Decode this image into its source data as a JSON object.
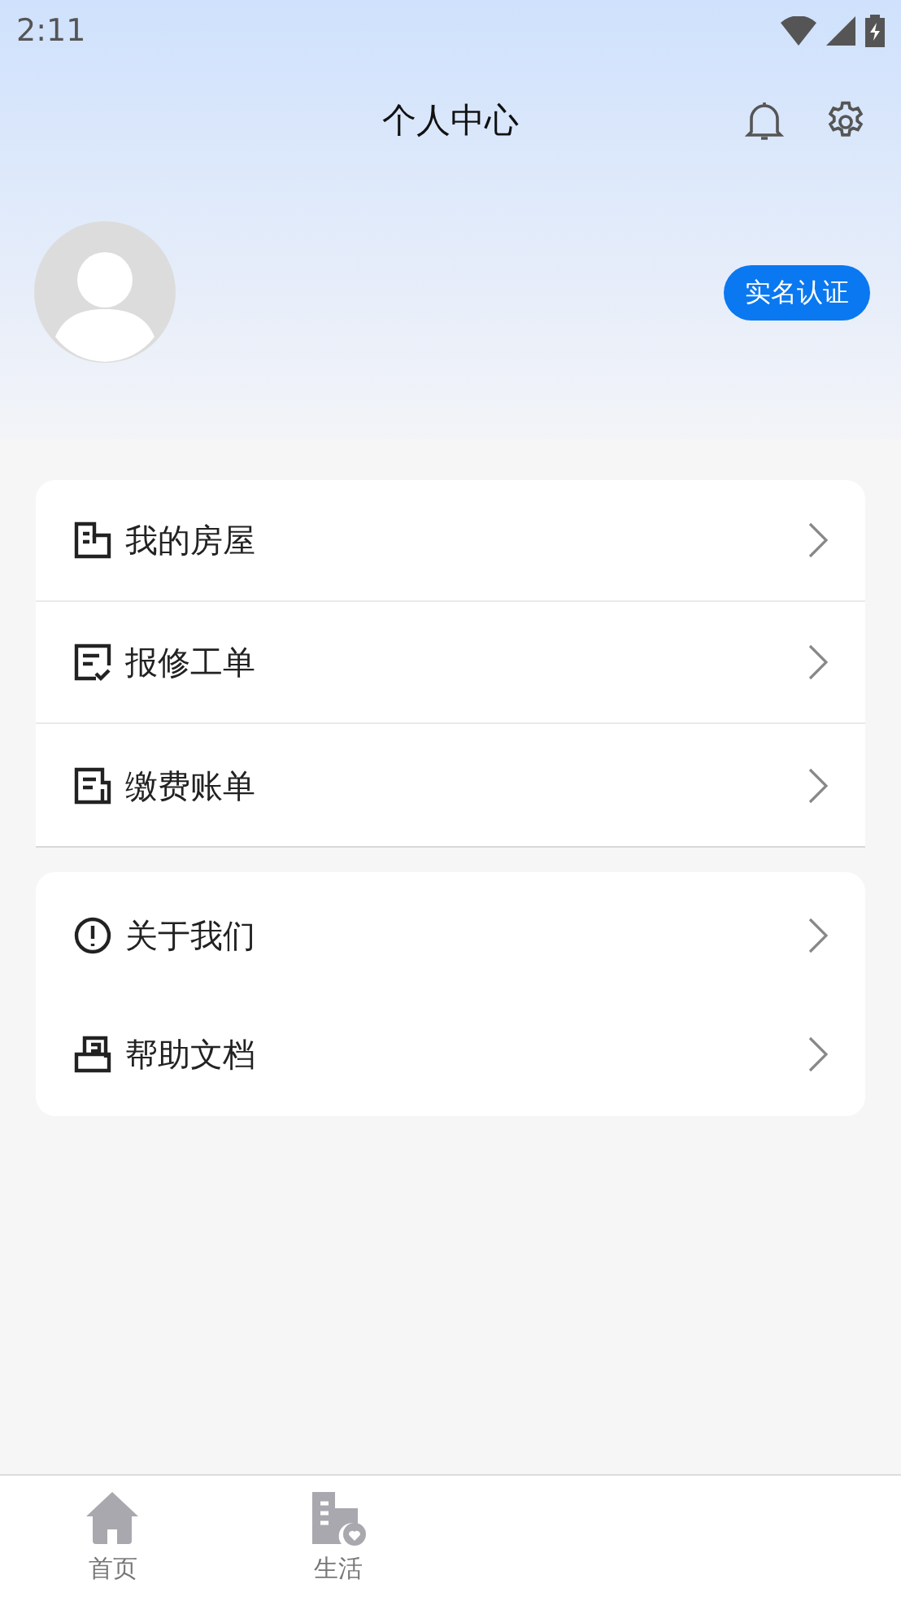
{
  "status_bar": {
    "time": "2:11"
  },
  "header": {
    "title": "个人中心"
  },
  "profile": {
    "verify_button": "实名认证"
  },
  "menu_groups": [
    {
      "items": [
        {
          "label": "我的房屋",
          "kind": "house"
        },
        {
          "label": "报修工单",
          "kind": "repair"
        },
        {
          "label": "缴费账单",
          "kind": "bill"
        }
      ]
    },
    {
      "items": [
        {
          "label": "关于我们",
          "kind": "info"
        },
        {
          "label": "帮助文档",
          "kind": "help"
        }
      ]
    }
  ],
  "tab_bar": [
    {
      "label": "首页",
      "kind": "home",
      "selected": false
    },
    {
      "label": "生活",
      "kind": "life",
      "selected": false
    }
  ]
}
